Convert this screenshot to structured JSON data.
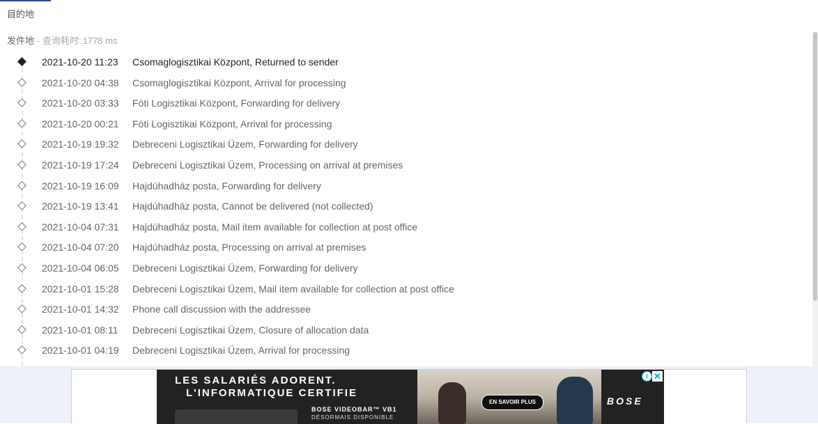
{
  "destination_label": "目的地",
  "origin": {
    "label": "发件地",
    "separator": "-",
    "query_label": "查询耗时:",
    "query_time": "1778 ms"
  },
  "events": [
    {
      "time": "2021-10-20 11:23",
      "desc": "Csomaglogisztikai Központ, Returned to sender",
      "current": true
    },
    {
      "time": "2021-10-20 04:38",
      "desc": "Csomaglogisztikai Központ, Arrival for processing"
    },
    {
      "time": "2021-10-20 03:33",
      "desc": "Fóti Logisztikai Központ, Forwarding for delivery"
    },
    {
      "time": "2021-10-20 00:21",
      "desc": "Fóti Logisztikai Központ, Arrival for processing"
    },
    {
      "time": "2021-10-19 19:32",
      "desc": "Debreceni Logisztikai Üzem, Forwarding for delivery"
    },
    {
      "time": "2021-10-19 17:24",
      "desc": "Debreceni Logisztikai Üzem, Processing on arrival at premises"
    },
    {
      "time": "2021-10-19 16:09",
      "desc": "Hajdúhadház posta, Forwarding for delivery"
    },
    {
      "time": "2021-10-19 13:41",
      "desc": "Hajdúhadház posta, Cannot be delivered (not collected)"
    },
    {
      "time": "2021-10-04 07:31",
      "desc": "Hajdúhadház posta, Mail item available for collection at post office"
    },
    {
      "time": "2021-10-04 07:20",
      "desc": "Hajdúhadház posta, Processing on arrival at premises"
    },
    {
      "time": "2021-10-04 06:05",
      "desc": "Debreceni Logisztikai Üzem, Forwarding for delivery"
    },
    {
      "time": "2021-10-01 15:28",
      "desc": "Debreceni Logisztikai Üzem, Mail item available for collection at post office"
    },
    {
      "time": "2021-10-01 14:32",
      "desc": "Phone call discussion with the addressee"
    },
    {
      "time": "2021-10-01 08:11",
      "desc": "Debreceni Logisztikai Üzem, Closure of allocation data"
    },
    {
      "time": "2021-10-01 04:19",
      "desc": "Debreceni Logisztikai Üzem, Arrival for processing"
    }
  ],
  "ad": {
    "headline_1": "LES SALARIÉS ADORENT.",
    "headline_2": "L'INFORMATIQUE CERTIFIE",
    "product": "BOSE VIDEOBAR™ VB1",
    "subline": "DÉSORMAIS DISPONIBLE",
    "cta": "EN SAVOIR PLUS",
    "brand": "BOSE",
    "info_glyph": "i",
    "close_glyph": "✕"
  }
}
